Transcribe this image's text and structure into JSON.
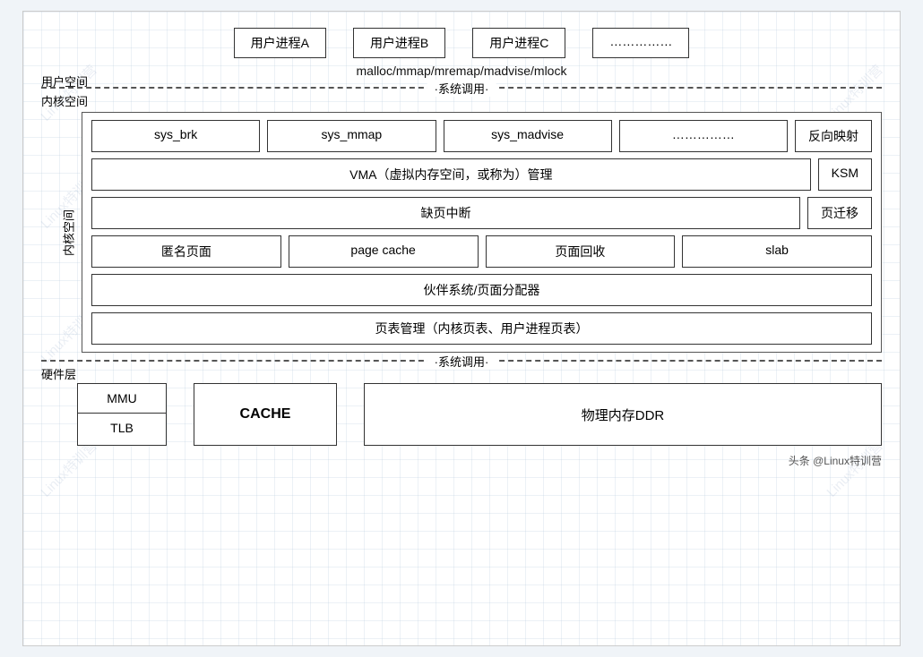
{
  "user_processes": {
    "label": "用户空间",
    "processes": [
      "用户进程A",
      "用户进程B",
      "用户进程C",
      "……………"
    ],
    "malloc_text": "malloc/mmap/mremap/madvise/mlock"
  },
  "separators": {
    "syscall_label": "·系统调用·",
    "syscall_label2": "·系统调用·"
  },
  "kernel": {
    "label": "内核空间",
    "inner_label": "内核空间",
    "row1": [
      "sys_brk",
      "sys_mmap",
      "sys_madvise",
      "……………",
      "反向映射"
    ],
    "row2_main": "VMA（虚拟内存空间，或称为）管理",
    "row2_side": "KSM",
    "row3_main": "缺页中断",
    "row3_side": "页迁移",
    "row4": [
      "匿名页面",
      "page cache",
      "页面回收",
      "slab"
    ],
    "row5": "伙伴系统/页面分配器",
    "row6": "页表管理（内核页表、用户进程页表）"
  },
  "hardware": {
    "label": "硬件层",
    "mmu": "MMU",
    "tlb": "TLB",
    "cache": "CACHE",
    "ddr": "物理内存DDR"
  },
  "footer": {
    "text": "头条 @Linux特训营"
  }
}
